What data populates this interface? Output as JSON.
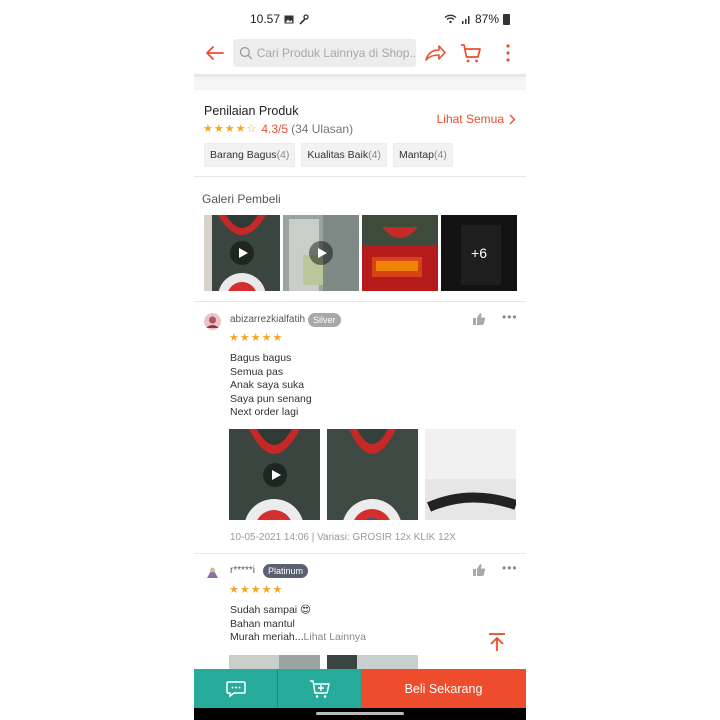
{
  "status": {
    "time": "10.57",
    "battery": "87%"
  },
  "search": {
    "placeholder": "Cari Produk Lainnya di Shop..."
  },
  "rating": {
    "title": "Penilaian Produk",
    "score": "4.3/5",
    "count": "(34 Ulasan)",
    "stars": 4.3,
    "see_all": "Lihat Semua",
    "chips": [
      {
        "label": "Barang Bagus",
        "count": "(4)"
      },
      {
        "label": "Kualitas Baik",
        "count": "(4)"
      },
      {
        "label": "Mantap",
        "count": "(4)"
      }
    ]
  },
  "gallery": {
    "title": "Galeri Pembeli",
    "more": "+6"
  },
  "reviews": [
    {
      "user": "abizarrezkialfatih",
      "badge": "Silver",
      "stars": 5,
      "lines": [
        "Bagus bagus",
        "Semua pas",
        "Anak saya suka",
        "Saya pun senang",
        "Next order lagi"
      ],
      "meta": "10-05-2021 14:06 | Variasi: GROSIR 12x KLIK 12X"
    },
    {
      "user": "r*****i",
      "badge": "Platinum",
      "stars": 5,
      "lines": [
        "Sudah sampai 😍",
        "Bahan mantul",
        "Murah meriah..."
      ],
      "more": "Lihat Lainnya"
    }
  ],
  "bottom": {
    "buy": "Beli Sekarang"
  },
  "colors": {
    "accent": "#ee4d2d",
    "teal": "#26aa99",
    "star": "#f5a623"
  }
}
